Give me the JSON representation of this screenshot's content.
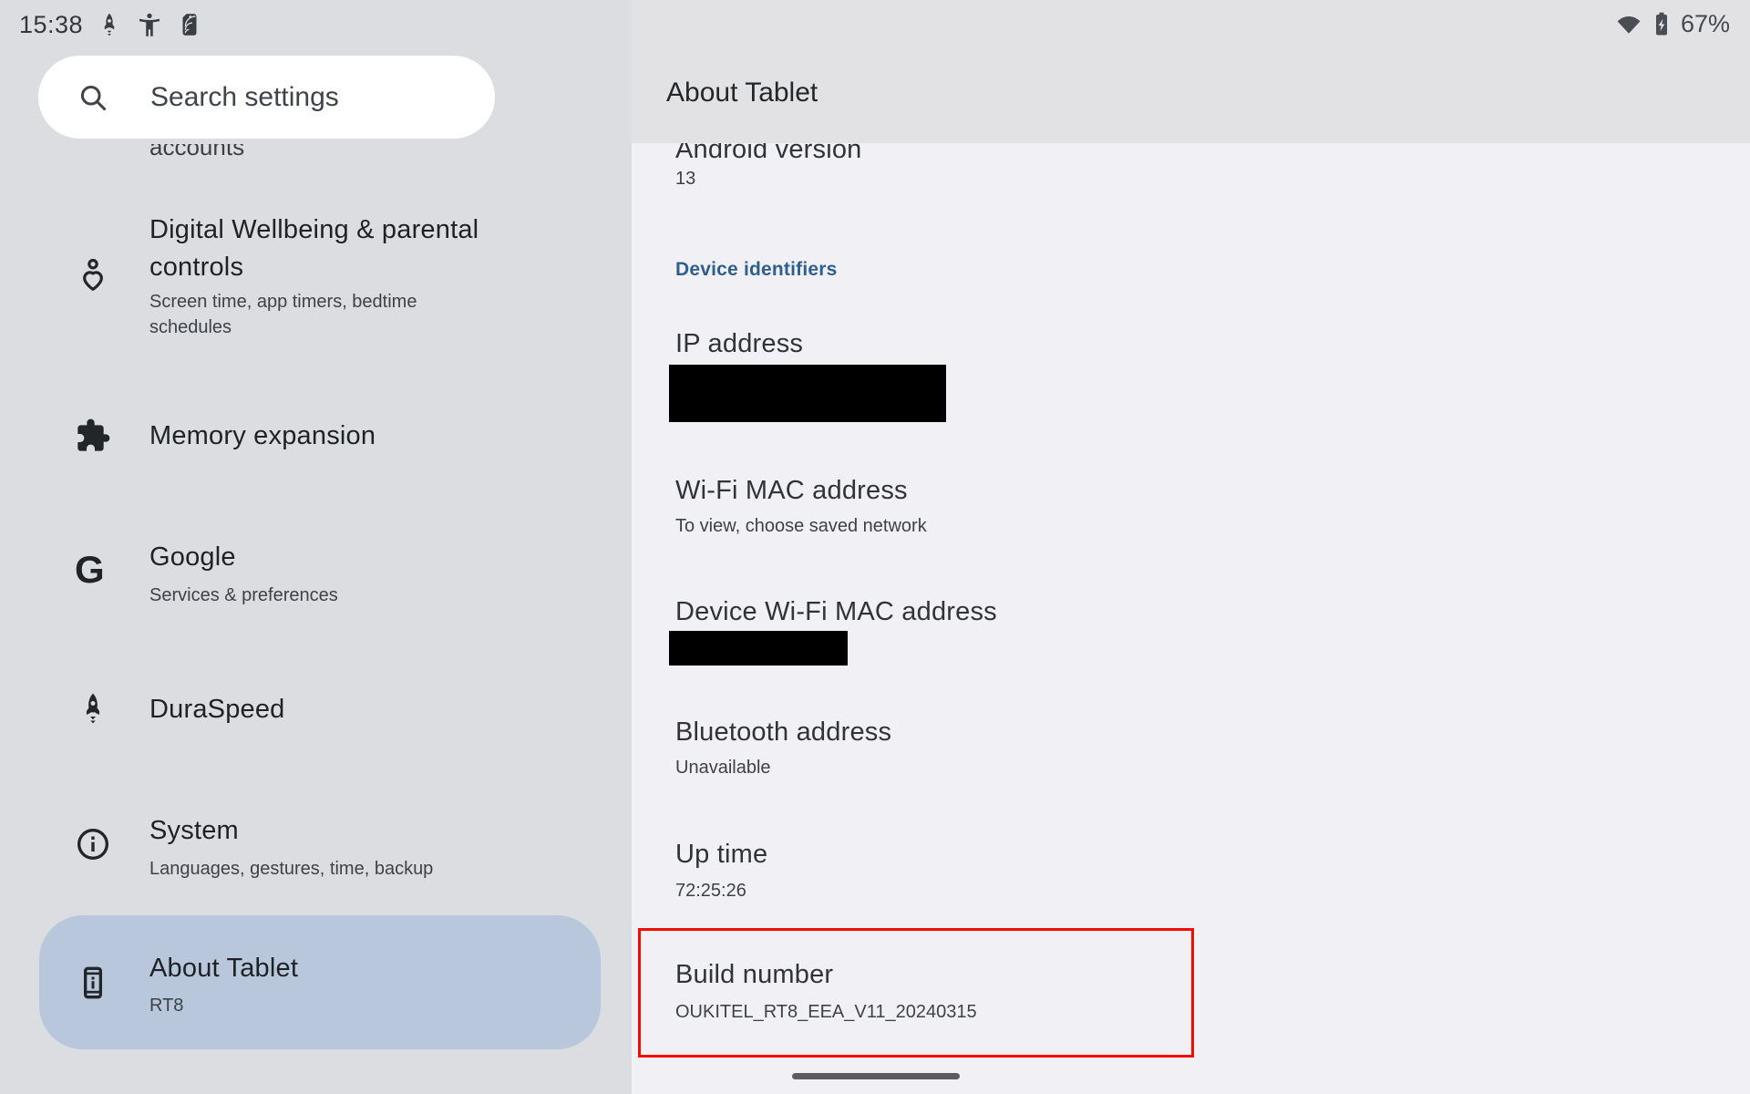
{
  "colors": {
    "sidebar_bg": "#dcdde1",
    "header_bg": "#e2e2e4",
    "content_bg": "#f1f1f5",
    "selected_pill": "#b8c7dc",
    "section_blue": "#2e5f8e",
    "annotation_red": "#f20d00",
    "redaction_black": "#000000"
  },
  "status_bar": {
    "time": "15:38",
    "battery_percent": "67%",
    "left_icons": [
      "rocket-icon",
      "accessibility-icon",
      "nfc-tag-icon"
    ],
    "right_icons": [
      "wifi-icon",
      "battery-charging-icon"
    ]
  },
  "sidebar": {
    "search_placeholder": "Search settings",
    "clipped_item_text": "accounts",
    "items": [
      {
        "title": "Digital Wellbeing & parental\ncontrols",
        "subtitle": "Screen time, app timers, bedtime\nschedules",
        "icon": "digital-wellbeing-icon"
      },
      {
        "title": "Memory expansion",
        "subtitle": "",
        "icon": "puzzle-icon"
      },
      {
        "title": "Google",
        "subtitle": "Services & preferences",
        "icon": "google-g-icon"
      },
      {
        "title": "DuraSpeed",
        "subtitle": "",
        "icon": "rocket-icon"
      },
      {
        "title": "System",
        "subtitle": "Languages, gestures, time, backup",
        "icon": "info-icon"
      },
      {
        "title": "About Tablet",
        "subtitle": "RT8",
        "icon": "tablet-icon",
        "selected": true
      }
    ]
  },
  "main": {
    "header_title": "About Tablet",
    "android_version": {
      "title": "Android version",
      "value": "13"
    },
    "section_label": "Device identifiers",
    "rows": [
      {
        "title": "IP address",
        "value": "",
        "redacted": true
      },
      {
        "title": "Wi-Fi MAC address",
        "value": "To view, choose saved network"
      },
      {
        "title": "Device Wi-Fi MAC address",
        "value": "",
        "redacted": true
      },
      {
        "title": "Bluetooth address",
        "value": "Unavailable"
      },
      {
        "title": "Up time",
        "value": "72:25:26"
      },
      {
        "title": "Build number",
        "value": "OUKITEL_RT8_EEA_V11_20240315",
        "highlighted": true
      }
    ]
  }
}
